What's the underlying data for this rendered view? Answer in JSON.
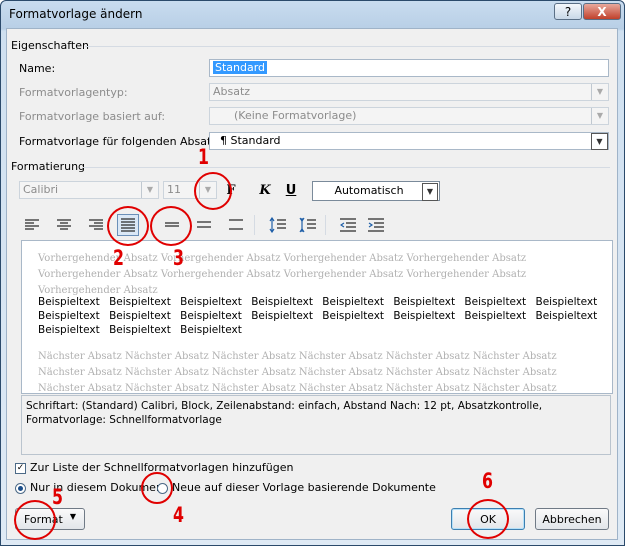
{
  "window": {
    "title": "Formatvorlage ändern",
    "help": "?",
    "close": "X"
  },
  "properties": {
    "group_title": "Eigenschaften",
    "name_label": "Name:",
    "name_value": "Standard",
    "type_label": "Formatvorlagentyp:",
    "type_value": "Absatz",
    "based_label": "Formatvorlage basiert auf:",
    "based_value": "(Keine Formatvorlage)",
    "next_label": "Formatvorlage für folgenden Absatz:",
    "next_value": "¶ Standard"
  },
  "formatting": {
    "group_title": "Formatierung",
    "font": "Calibri",
    "size": "11",
    "bold": "F",
    "italic": "K",
    "underline": "U",
    "color": "Automatisch"
  },
  "preview": {
    "previous": "Vorhergehender Absatz Vorhergehender Absatz Vorhergehender Absatz Vorhergehender Absatz Vorhergehender Absatz Vorhergehender Absatz Vorhergehender Absatz Vorhergehender Absatz Vorhergehender Absatz",
    "sample": "Beispieltext Beispieltext Beispieltext Beispieltext Beispieltext Beispieltext Beispieltext Beispieltext Beispieltext Beispieltext Beispieltext Beispieltext Beispieltext Beispieltext Beispieltext Beispieltext Beispieltext Beispieltext Beispieltext",
    "next": "Nächster Absatz Nächster Absatz Nächster Absatz Nächster Absatz Nächster Absatz Nächster Absatz Nächster Absatz Nächster Absatz Nächster Absatz Nächster Absatz Nächster Absatz Nächster Absatz Nächster Absatz Nächster Absatz Nächster Absatz Nächster Absatz Nächster Absatz Nächster Absatz Nächster Absatz Nächster Absatz"
  },
  "description": "Schriftart: (Standard) Calibri, Block, Zeilenabstand:  einfach, Abstand Nach:  12 pt, Absatzkontrolle, Formatvorlage: Schnellformatvorlage",
  "options": {
    "quicklist_label": "Zur Liste der Schnellformatvorlagen hinzufügen",
    "quicklist_checked": true,
    "only_doc_label": "Nur in diesem Dokument",
    "new_docs_label": "Neue auf dieser Vorlage basierende Dokumente"
  },
  "buttons": {
    "format": "Format",
    "ok": "OK",
    "cancel": "Abbrechen"
  },
  "annotations": [
    "1",
    "2",
    "3",
    "4",
    "5",
    "6"
  ],
  "annotation_color": "#e00000"
}
